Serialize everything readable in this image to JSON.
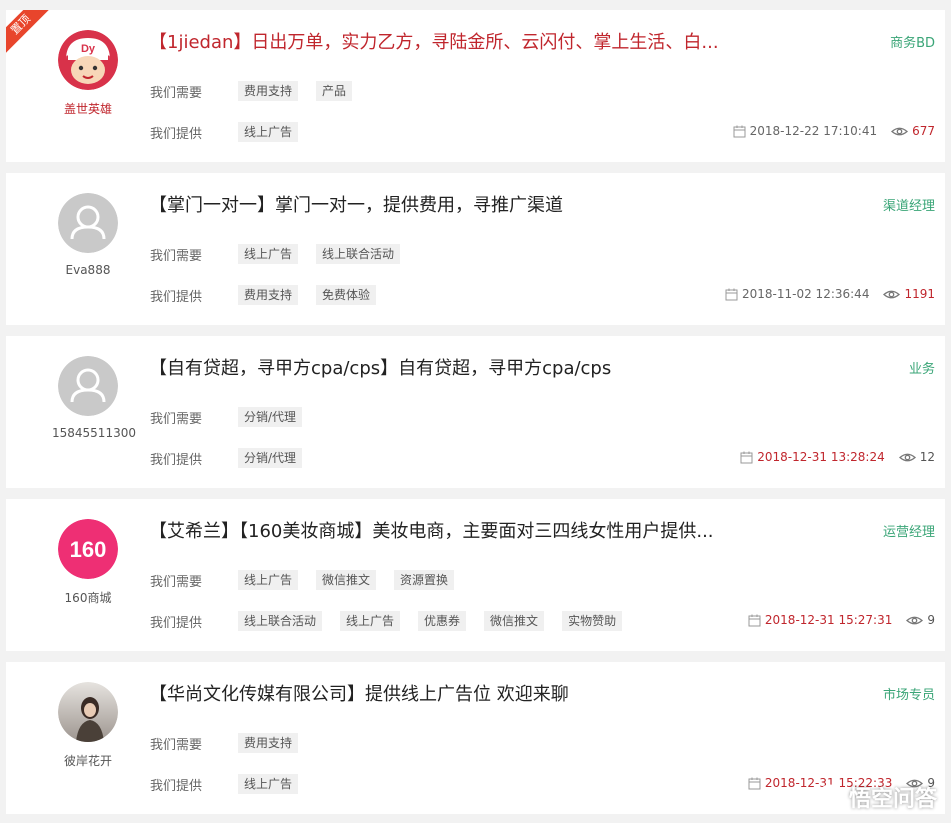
{
  "labels": {
    "need": "我们需要",
    "give": "我们提供"
  },
  "items": [
    {
      "badge": "置顶",
      "username": "盖世英雄",
      "avatar_icon": "cartoon-boy-icon",
      "title": "【1jiedan】日出万单，实力乙方，寻陆金所、云闪付、掌上生活、白...",
      "role": "商务BD",
      "need": [
        "费用支持",
        "产品"
      ],
      "give": [
        "线上广告"
      ],
      "date": "2018-12-22 17:10:41",
      "views": "677"
    },
    {
      "username": "Eva888",
      "avatar_icon": "default-user-icon",
      "title": "【掌门一对一】掌门一对一，提供费用，寻推广渠道",
      "role": "渠道经理",
      "need": [
        "线上广告",
        "线上联合活动"
      ],
      "give": [
        "费用支持",
        "免费体验"
      ],
      "date": "2018-11-02 12:36:44",
      "views": "1191"
    },
    {
      "username": "15845511300",
      "avatar_icon": "default-user-icon",
      "title": "【自有贷超，寻甲方cpa/cps】自有贷超，寻甲方cpa/cps",
      "role": "业务",
      "need": [
        "分销/代理"
      ],
      "give": [
        "分销/代理"
      ],
      "date": "2018-12-31 13:28:24",
      "views": "12"
    },
    {
      "username": "160商城",
      "avatar_icon": "160-logo-icon",
      "avatar_text": "160",
      "title": "【艾希兰】【160美妆商城】美妆电商，主要面对三四线女性用户提供...",
      "role": "运营经理",
      "need": [
        "线上广告",
        "微信推文",
        "资源置换"
      ],
      "give": [
        "线上联合活动",
        "线上广告",
        "优惠券",
        "微信推文",
        "实物赞助"
      ],
      "date": "2018-12-31 15:27:31",
      "views": "9"
    },
    {
      "username": "彼岸花开",
      "avatar_icon": "photo-avatar-icon",
      "title": "【华尚文化传媒有限公司】提供线上广告位 欢迎来聊",
      "role": "市场专员",
      "need": [
        "费用支持"
      ],
      "give": [
        "线上广告"
      ],
      "date": "2018-12-31 15:22:33",
      "views": "9"
    }
  ],
  "watermark": {
    "text": "悟空问答",
    "icon": "wukong-logo-icon"
  }
}
